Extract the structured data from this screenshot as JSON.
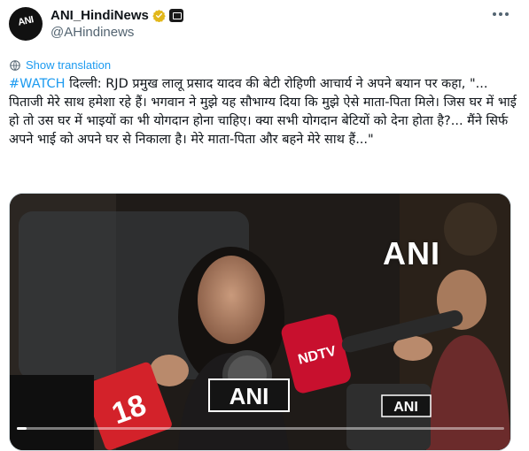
{
  "author": {
    "display_name": "ANI_HindiNews",
    "handle": "@AHindinews",
    "avatar_text": "ANI",
    "verified_badge": "gold-check-icon",
    "affiliation_icon": "tv-icon"
  },
  "translate": {
    "label": "Show translation",
    "icon": "globe-icon"
  },
  "tweet": {
    "hashtag": "#WATCH",
    "text": " दिल्ली: RJD प्रमुख लालू प्रसाद यादव की बेटी रोहिणी आचार्य ने अपने बयान पर कहा, \"... पिताजी मेरे साथ हमेशा रहे हैं। भगवान ने मुझे यह सौभाग्य दिया कि मुझे ऐसे माता-पिता मिले। जिस घर में भाई हो तो उस घर में भाइयों का भी योगदान होना चाहिए। क्या सभी योगदान बेटियों को देना होता है?... मैंने सिर्फ अपने भाई को अपने घर से निकाला है। मेरे माता-पिता और बहने मेरे साथ हैं...\""
  },
  "video": {
    "watermark": "ANI",
    "mic_logos": [
      "ANI",
      "ANI",
      "18",
      "NDTV"
    ],
    "progress": 0.02
  },
  "colors": {
    "accent": "#1d9bf0",
    "secondary_text": "#536471",
    "badge_gold": "#e2b719",
    "mic_red": "#d3222a"
  }
}
